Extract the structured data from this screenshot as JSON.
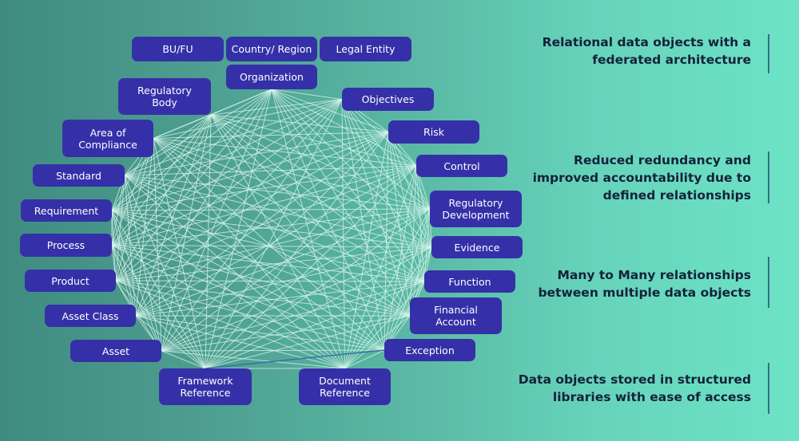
{
  "diagram": {
    "nodes": [
      {
        "id": "bu-fu",
        "label": "BU/FU"
      },
      {
        "id": "country-region",
        "label": "Country/ Region"
      },
      {
        "id": "legal-entity",
        "label": "Legal Entity"
      },
      {
        "id": "organization",
        "label": "Organization"
      },
      {
        "id": "regulatory-body",
        "label": "Regulatory Body"
      },
      {
        "id": "objectives",
        "label": "Objectives"
      },
      {
        "id": "area-of-compliance",
        "label": "Area of Compliance"
      },
      {
        "id": "risk",
        "label": "Risk"
      },
      {
        "id": "standard",
        "label": "Standard"
      },
      {
        "id": "control",
        "label": "Control"
      },
      {
        "id": "requirement",
        "label": "Requirement"
      },
      {
        "id": "regulatory-development",
        "label": "Regulatory Development"
      },
      {
        "id": "process",
        "label": "Process"
      },
      {
        "id": "evidence",
        "label": "Evidence"
      },
      {
        "id": "product",
        "label": "Product"
      },
      {
        "id": "function",
        "label": "Function"
      },
      {
        "id": "asset-class",
        "label": "Asset Class"
      },
      {
        "id": "financial-account",
        "label": "Financial Account"
      },
      {
        "id": "asset",
        "label": "Asset"
      },
      {
        "id": "exception",
        "label": "Exception"
      },
      {
        "id": "framework-reference",
        "label": "Framework Reference"
      },
      {
        "id": "document-reference",
        "label": "Document Reference"
      }
    ],
    "connectivity": "all-to-all mesh between the objects around the ring",
    "highlighted_edge": {
      "from": "framework-reference",
      "to": "exception"
    },
    "colors": {
      "node_fill": "#3530a8",
      "node_text": "#ffffff",
      "edge": "#d8f5ea",
      "highlighted_edge": "#3a6fa8"
    }
  },
  "features": [
    {
      "lines": [
        "Relational data objects with a",
        "federated architecture"
      ]
    },
    {
      "lines": [
        "Reduced redundancy and",
        "improved accountability due to",
        "defined relationships"
      ]
    },
    {
      "lines": [
        "Many to Many relationships",
        "between multiple data objects"
      ]
    },
    {
      "lines": [
        "Data objects stored in structured",
        "libraries with ease of access"
      ]
    }
  ],
  "colors": {
    "feature_text": "#14213a",
    "separator": "#2f6f86",
    "background_left": "#3f8b80",
    "background_right": "#6de3c6"
  }
}
